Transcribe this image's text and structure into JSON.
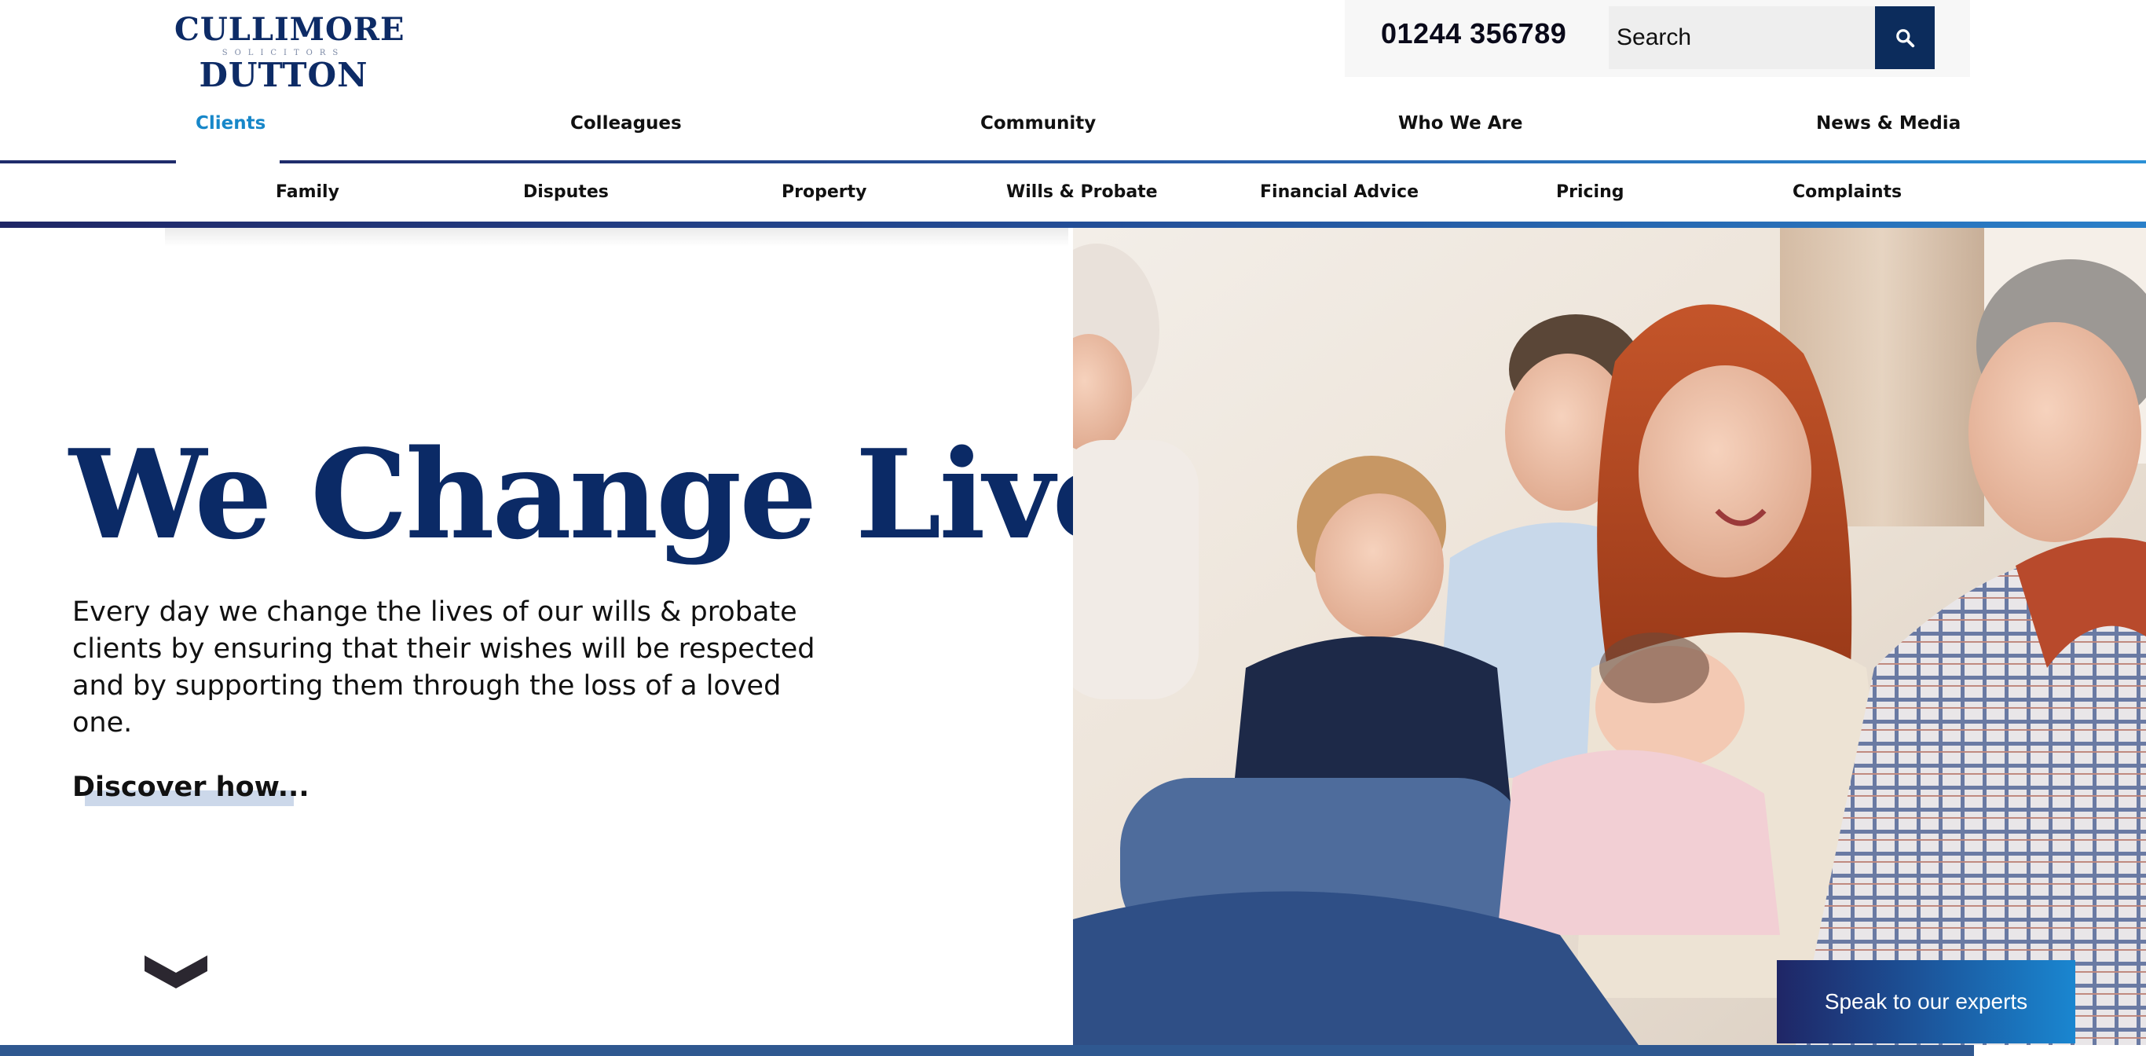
{
  "logo": {
    "line1": "CULLIMORE",
    "line2": "SOLICITORS",
    "line3": "DUTTON"
  },
  "header": {
    "phone": "01244 356789",
    "search": {
      "placeholder": "Search",
      "value": ""
    },
    "search_icon": "search-icon"
  },
  "primary_nav": {
    "active": "Clients",
    "items": [
      {
        "label": "Clients"
      },
      {
        "label": "Colleagues"
      },
      {
        "label": "Community"
      },
      {
        "label": "Who We Are"
      },
      {
        "label": "News & Media"
      }
    ]
  },
  "secondary_nav": {
    "items": [
      {
        "label": "Family"
      },
      {
        "label": "Disputes"
      },
      {
        "label": "Property"
      },
      {
        "label": "Wills & Probate"
      },
      {
        "label": "Financial Advice"
      },
      {
        "label": "Pricing"
      },
      {
        "label": "Complaints"
      }
    ]
  },
  "hero": {
    "title": "We Change Lives",
    "body": "Every day we change the lives of our wills & probate clients by ensuring that their wishes will be respected and by supporting them through the loss of a loved one.",
    "link": "Discover how...",
    "scroll_icon": "chevron-down-icon"
  },
  "cta": {
    "label": "Speak to our experts"
  },
  "scroll_progress": 0.92,
  "colors": {
    "brand_navy": "#0b2a66",
    "active_link": "#1787c9",
    "search_button": "#0c2c5c",
    "gradient_start": "#1f2666",
    "gradient_end": "#2a7fc8"
  }
}
